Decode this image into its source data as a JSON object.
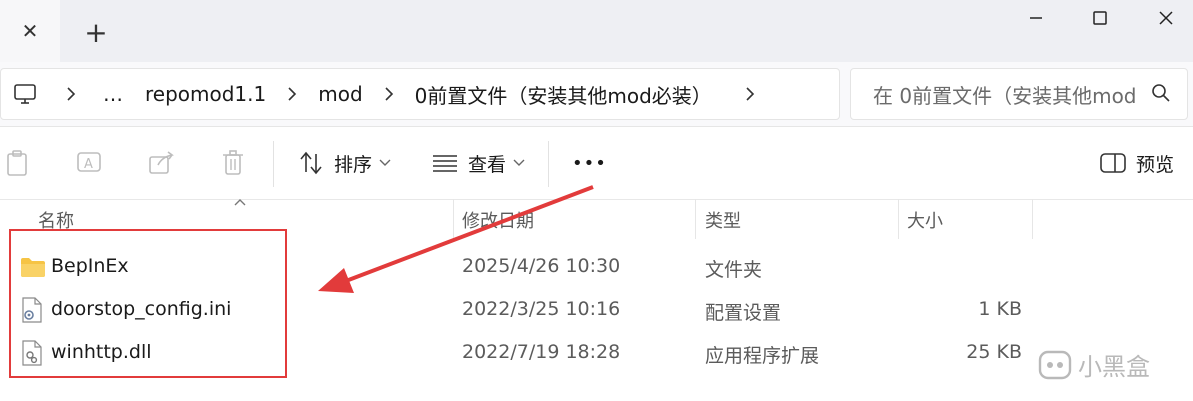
{
  "window": {
    "new_tab_symbol": "+",
    "close_tab_symbol": "✕"
  },
  "address": {
    "breadcrumbs": [
      "…",
      "repomod1.1",
      "mod",
      "0前置文件（安装其他mod必装）"
    ]
  },
  "search": {
    "placeholder": "在 0前置文件（安装其他mod"
  },
  "toolbar": {
    "sort_label": "排序",
    "view_label": "查看",
    "more_label": "•••",
    "preview_label": "预览"
  },
  "columns": {
    "name": "名称",
    "modified": "修改日期",
    "type": "类型",
    "size": "大小"
  },
  "files": [
    {
      "name": "BepInEx",
      "modified": "2025/4/26 10:30",
      "type": "文件夹",
      "size": "",
      "icon": "folder-icon"
    },
    {
      "name": "doorstop_config.ini",
      "modified": "2022/3/25 10:16",
      "type": "配置设置",
      "size": "1 KB",
      "icon": "config-file-icon"
    },
    {
      "name": "winhttp.dll",
      "modified": "2022/7/19 18:28",
      "type": "应用程序扩展",
      "size": "25 KB",
      "icon": "dll-file-icon"
    }
  ],
  "watermark": {
    "text": "小黑盒"
  },
  "colors": {
    "accent": "#005fb8",
    "highlight": "#e23b3b",
    "folder": "#f6c445"
  }
}
